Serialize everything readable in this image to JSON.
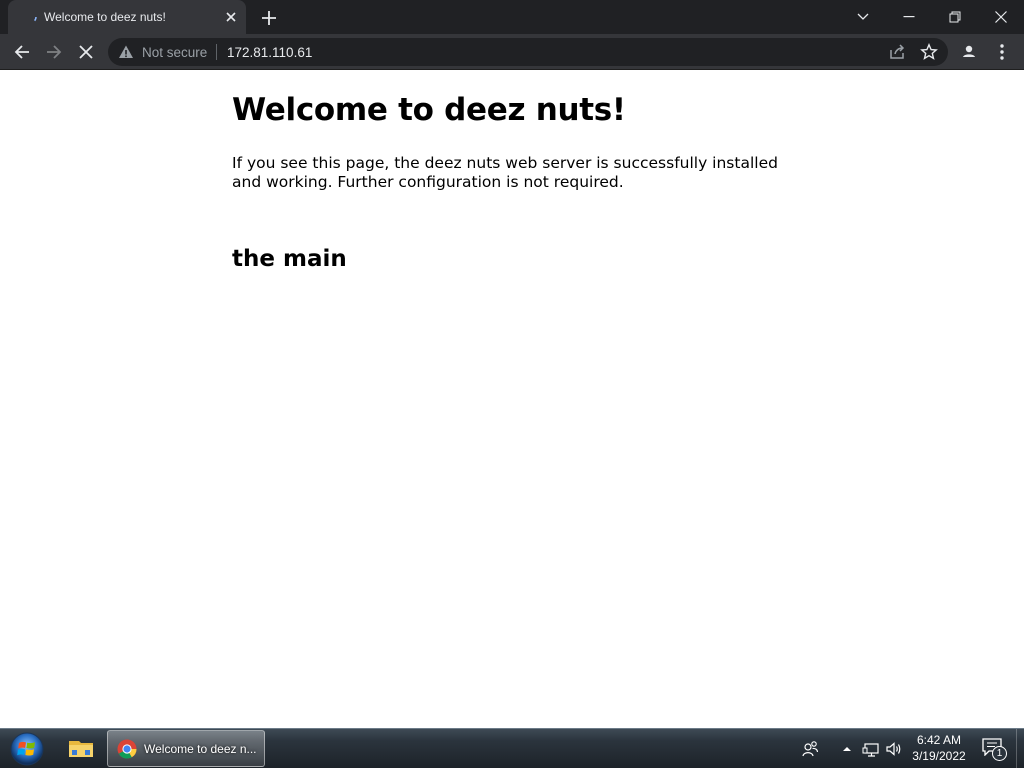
{
  "browser": {
    "tab": {
      "title": "Welcome to deez nuts!"
    },
    "address": {
      "security_label": "Not secure",
      "url": "172.81.110.61"
    }
  },
  "page": {
    "heading": "Welcome to deez nuts!",
    "paragraph": "If you see this page, the deez nuts web server is successfully installed and working. Further configuration is not required.",
    "subheading": "the main"
  },
  "taskbar": {
    "chrome_window_label": "Welcome to deez n...",
    "clock": {
      "time": "6:42 AM",
      "date": "3/19/2022"
    },
    "action_center_count": "1"
  },
  "colors": {
    "chrome_frame": "#202124",
    "chrome_toolbar": "#35363a",
    "page_background": "#ffffff",
    "page_text": "#000000"
  }
}
